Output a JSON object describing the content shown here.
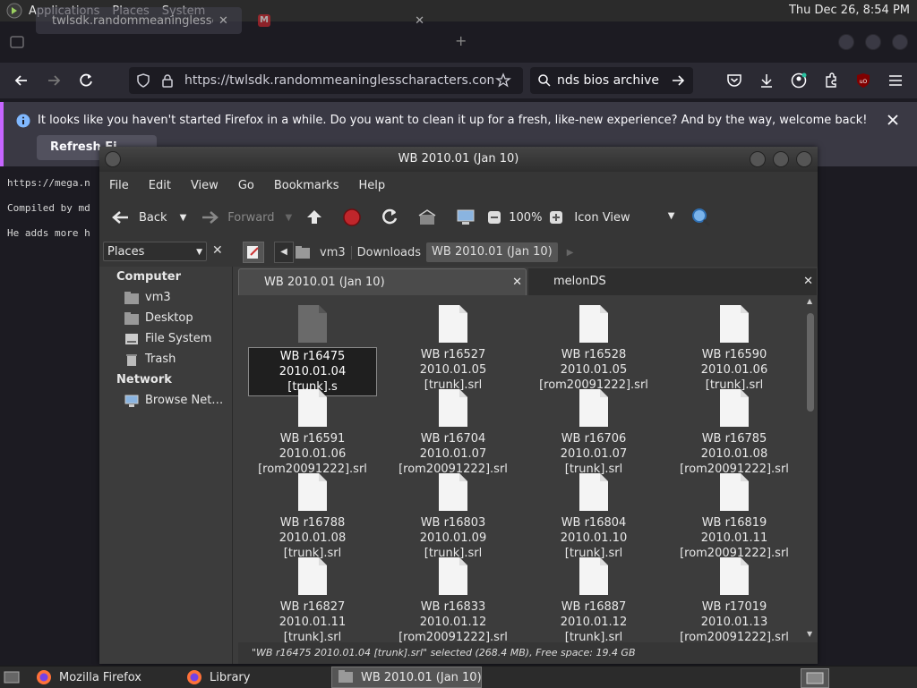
{
  "top_panel": {
    "menus": [
      "Applications",
      "Places",
      "System"
    ],
    "clock": "Thu Dec 26,  8:54 PM"
  },
  "firefox": {
    "tabs": [
      {
        "label": "twlsdk.randommeaninglesschar"
      },
      {
        "label": ""
      }
    ],
    "url": "https://twlsdk.randommeaninglesscharacters.com/fre",
    "search_value": "nds bios archive",
    "notification": "It looks like you haven't started Firefox in a while. Do you want to clean it up for a fresh, like-new experience? And by the way, welcome back!",
    "refresh_button": "Refresh Fi"
  },
  "page_text": [
    "https://mega.n",
    "Compiled by md",
    "He adds more h"
  ],
  "nautilus": {
    "title": "WB 2010.01 (Jan 10)",
    "menu": [
      "File",
      "Edit",
      "View",
      "Go",
      "Bookmarks",
      "Help"
    ],
    "toolbar": {
      "back": "Back",
      "forward": "Forward",
      "zoom": "100%",
      "view_mode": "Icon View"
    },
    "sidebar_combo": "Places",
    "breadcrumb": [
      "vm3",
      "Downloads",
      "WB 2010.01 (Jan 10)"
    ],
    "sidebar": {
      "computer_header": "Computer",
      "computer_items": [
        "vm3",
        "Desktop",
        "File System",
        "Trash"
      ],
      "network_header": "Network",
      "network_items": [
        "Browse Net…"
      ]
    },
    "tabs": [
      "WB 2010.01 (Jan 10)",
      "melonDS"
    ],
    "files": [
      {
        "line1": "WB r16475 2010.01.04",
        "line2": "[trunk].s",
        "selected": true
      },
      {
        "line1": "WB r16527 2010.01.05",
        "line2": "[trunk].srl"
      },
      {
        "line1": "WB r16528 2010.01.05",
        "line2": "[rom20091222].srl"
      },
      {
        "line1": "WB r16590 2010.01.06",
        "line2": "[trunk].srl"
      },
      {
        "line1": "WB r16591 2010.01.06",
        "line2": "[rom20091222].srl"
      },
      {
        "line1": "WB r16704 2010.01.07",
        "line2": "[rom20091222].srl"
      },
      {
        "line1": "WB r16706 2010.01.07",
        "line2": "[trunk].srl"
      },
      {
        "line1": "WB r16785 2010.01.08",
        "line2": "[rom20091222].srl"
      },
      {
        "line1": "WB r16788 2010.01.08",
        "line2": "[trunk].srl"
      },
      {
        "line1": "WB r16803 2010.01.09",
        "line2": "[trunk].srl"
      },
      {
        "line1": "WB r16804 2010.01.10",
        "line2": "[trunk].srl"
      },
      {
        "line1": "WB r16819 2010.01.11",
        "line2": "[rom20091222].srl"
      },
      {
        "line1": "WB r16827 2010.01.11",
        "line2": "[trunk].srl"
      },
      {
        "line1": "WB r16833 2010.01.12",
        "line2": "[rom20091222].srl"
      },
      {
        "line1": "WB r16887 2010.01.12",
        "line2": "[trunk].srl"
      },
      {
        "line1": "WB r17019 2010.01.13",
        "line2": "[rom20091222].srl"
      }
    ],
    "status": "\"WB r16475 2010.01.04 [trunk].srl\" selected (268.4 MB), Free space: 19.4 GB"
  },
  "taskbar": [
    {
      "label": "Mozilla Firefox",
      "icon": "firefox-icon"
    },
    {
      "label": "Library",
      "icon": "firefox-icon"
    },
    {
      "label": "WB 2010.01 (Jan 10)",
      "icon": "folder-icon",
      "active": true
    }
  ],
  "colors": {
    "accent": "#c665ff",
    "info": "#80ebff"
  }
}
